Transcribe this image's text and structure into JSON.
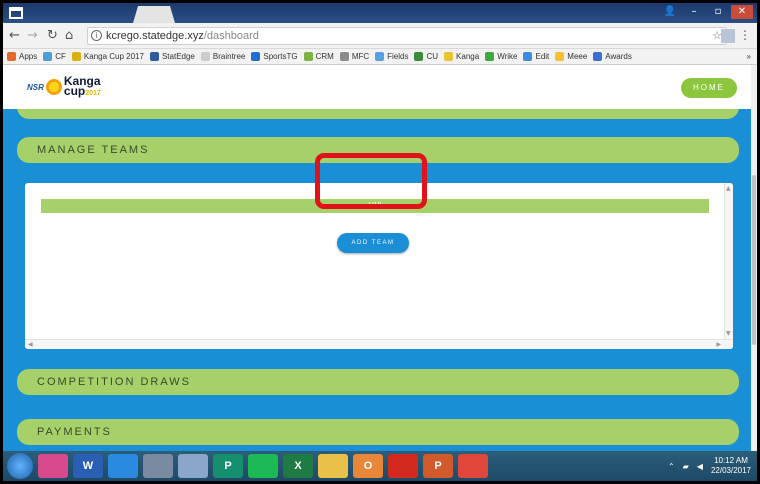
{
  "browser": {
    "url_host": "kcrego.statedge.xyz",
    "url_path": "/dashboard",
    "bookmarks": [
      {
        "label": "Apps",
        "color": "#e36a2a"
      },
      {
        "label": "CF",
        "color": "#4a9fd8"
      },
      {
        "label": "Kanga Cup 2017",
        "color": "#d9b10b"
      },
      {
        "label": "StatEdge",
        "color": "#2e5d9c"
      },
      {
        "label": "Braintree",
        "color": "#cccccc"
      },
      {
        "label": "SportsTG",
        "color": "#1f6fd1"
      },
      {
        "label": "CRM",
        "color": "#7cb342"
      },
      {
        "label": "MFC",
        "color": "#8a8a8a"
      },
      {
        "label": "Fields",
        "color": "#5aa0e0"
      },
      {
        "label": "CU",
        "color": "#3b8d3b"
      },
      {
        "label": "Kanga",
        "color": "#e5c531"
      },
      {
        "label": "Wrike",
        "color": "#3eaa3e"
      },
      {
        "label": "Edit",
        "color": "#3b8de0"
      },
      {
        "label": "Meee",
        "color": "#f2c230"
      },
      {
        "label": "Awards",
        "color": "#3b6fd1"
      }
    ],
    "bookmarks_more": "»"
  },
  "header": {
    "logo_nsr": "NSR",
    "logo_kanga": "Kanga",
    "logo_cup": "cup",
    "logo_year": "2017",
    "home_label": "HOME"
  },
  "sections": {
    "manage_teams": "MANAGE TEAMS",
    "competition_draws": "COMPETITION DRAWS",
    "payments": "PAYMENTS"
  },
  "teams": {
    "age_group": "U18",
    "add_team_label": "ADD TEAM"
  },
  "taskbar": {
    "apps": [
      {
        "label": "",
        "name": "itunes-icon",
        "color": "#d94a8c"
      },
      {
        "label": "W",
        "name": "word-icon",
        "color": "#2b5fb3"
      },
      {
        "label": "",
        "name": "camera-app-icon",
        "color": "#2a8ae0"
      },
      {
        "label": "",
        "name": "notepad-icon",
        "color": "#7a8aa0"
      },
      {
        "label": "",
        "name": "paint-icon",
        "color": "#8aa6c8"
      },
      {
        "label": "P",
        "name": "publisher-icon",
        "color": "#168f6e"
      },
      {
        "label": "",
        "name": "spotify-icon",
        "color": "#1db954"
      },
      {
        "label": "X",
        "name": "excel-icon",
        "color": "#1f7a44"
      },
      {
        "label": "",
        "name": "explorer-icon",
        "color": "#e8c04a"
      },
      {
        "label": "O",
        "name": "outlook-icon",
        "color": "#e8873a"
      },
      {
        "label": "",
        "name": "acrobat-icon",
        "color": "#d22a1e"
      },
      {
        "label": "P",
        "name": "powerpoint-icon",
        "color": "#d05a2c"
      },
      {
        "label": "",
        "name": "chrome-icon",
        "color": "#e0463a"
      }
    ],
    "time": "10:12 AM",
    "date": "22/03/2017"
  }
}
